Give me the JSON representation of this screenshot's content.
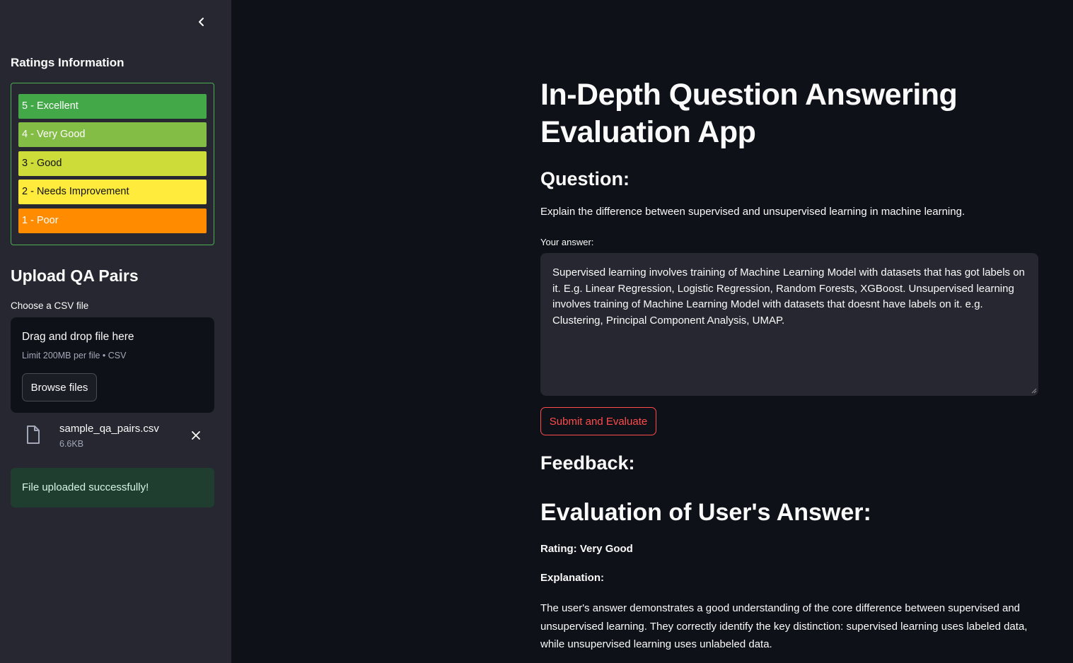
{
  "sidebar": {
    "ratings_heading": "Ratings Information",
    "ratings": [
      {
        "label": "5 - Excellent",
        "color": "#43a847"
      },
      {
        "label": "4 - Very Good",
        "color": "#84bd45"
      },
      {
        "label": "3 - Good",
        "color": "#cddc39"
      },
      {
        "label": "2 - Needs Improvement",
        "color": "#ffeb3b"
      },
      {
        "label": "1 - Poor",
        "color": "#ff8c00"
      }
    ],
    "upload_heading": "Upload QA Pairs",
    "uploader": {
      "label": "Choose a CSV file",
      "drop_text": "Drag and drop file here",
      "limit_text": "Limit 200MB per file • CSV",
      "browse_label": "Browse files"
    },
    "file": {
      "name": "sample_qa_pairs.csv",
      "size": "6.6KB"
    },
    "success_message": "File uploaded successfully!"
  },
  "main": {
    "title_line1": "In-Depth Question Answering",
    "title_line2": "Evaluation App",
    "question_heading": "Question:",
    "question_text": "Explain the difference between supervised and unsupervised learning in machine learning.",
    "answer_label": "Your answer:",
    "answer_value": "Supervised learning involves training of Machine Learning Model with datasets that has got labels on it. E.g. Linear Regression, Logistic Regression, Random Forests, XGBoost. Unsupervised learning involves training of Machine Learning Model with datasets that doesnt have labels on it. e.g. Clustering, Principal Component Analysis, UMAP.",
    "submit_label": "Submit and Evaluate",
    "feedback_heading": "Feedback:",
    "evaluation_heading": "Evaluation of User's Answer:",
    "rating_text": "Rating: Very Good",
    "explanation_label": "Explanation:",
    "explanation_text": "The user's answer demonstrates a good understanding of the core difference between supervised and unsupervised learning. They correctly identify the key distinction: supervised learning uses labeled data, while unsupervised learning uses unlabeled data."
  },
  "colors": {
    "accent": "#ff4b4b",
    "sidebar_bg": "#262730",
    "main_bg": "#0e1117",
    "success_bg": "#1f3e30"
  }
}
